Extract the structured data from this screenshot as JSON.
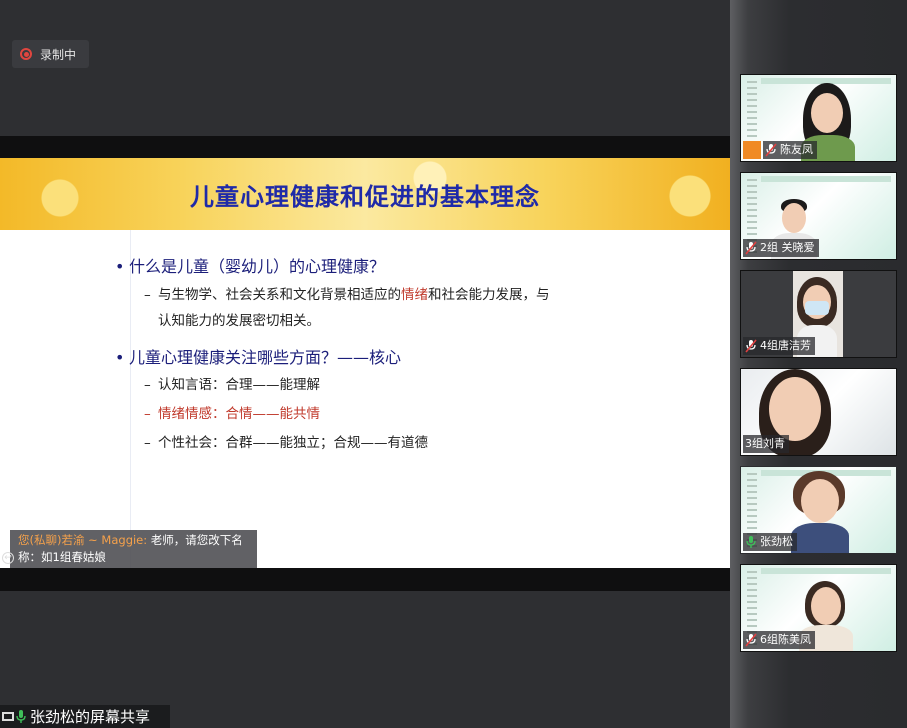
{
  "recording": {
    "label": "录制中"
  },
  "slide": {
    "title": "儿童心理健康和促进的基本理念",
    "bullet_1": "什么是儿童（婴幼儿）的心理健康？",
    "bullet_1_sub_line1_a": "与生物学、社会关系和文化背景相适应的",
    "bullet_1_sub_line1_red": "情绪",
    "bullet_1_sub_line1_b": "和社会能力发展，与",
    "bullet_1_sub_line2": "认知能力的发展密切相关。",
    "bullet_2": "儿童心理健康关注哪些方面？——核心",
    "bullet_2_sub_1": "认知言语：合理——能理解",
    "bullet_2_sub_2": "情绪情感：合情——能共情",
    "bullet_2_sub_3": "个性社会：合群——能独立；合规——有道德",
    "bullet_char": "•",
    "dash_char": "–",
    "red_color": "#c0392b",
    "title_color": "#1f2aa8"
  },
  "chat": {
    "sender": "您(私聊)若渝 ~ Maggie:",
    "message": " 老师，请您改下名",
    "message_line2": "称：如1组春姑娘"
  },
  "share": {
    "label": "张劲松的屏幕共享"
  },
  "participants": [
    {
      "name": "陈友凤"
    },
    {
      "name": "2组 关晓爱"
    },
    {
      "name": "4组唐洁芳"
    },
    {
      "name": "3组刘青"
    },
    {
      "name": "张劲松"
    },
    {
      "name": "6组陈美凤"
    }
  ]
}
